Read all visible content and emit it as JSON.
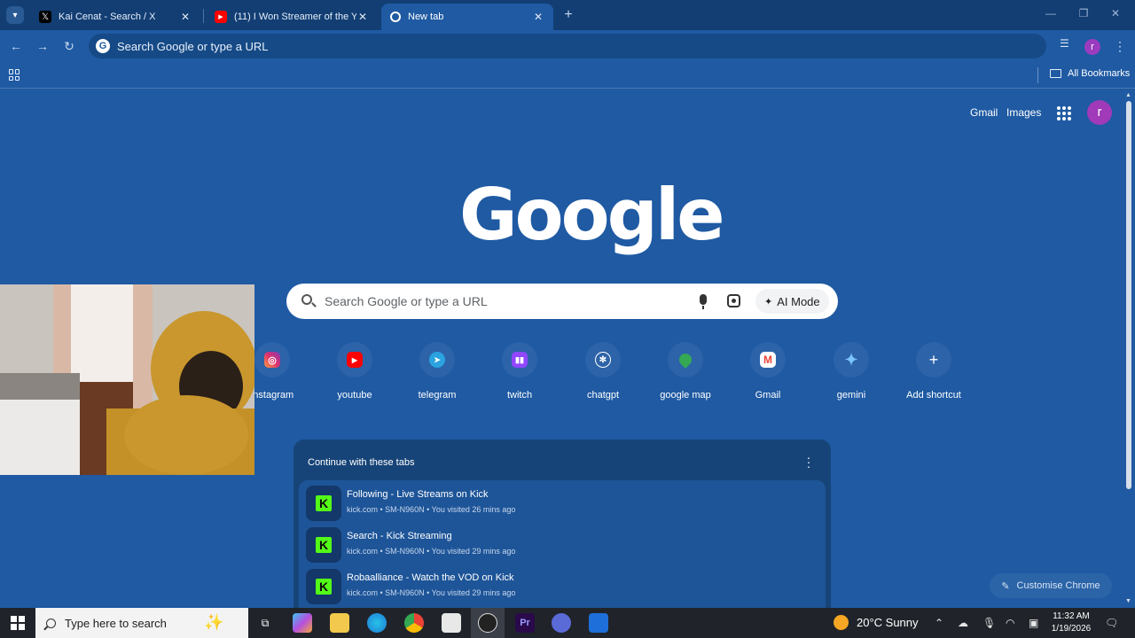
{
  "tabs": [
    {
      "title": "Kai Cenat - Search / X",
      "icon": "x-logo-icon"
    },
    {
      "title": "(11) I Won Streamer of the Year",
      "icon": "youtube-icon"
    },
    {
      "title": "New tab",
      "icon": "chrome-icon",
      "active": true
    }
  ],
  "omnibox": {
    "placeholder": "Search Google or type a URL"
  },
  "bookmarks": {
    "all_label": "All Bookmarks"
  },
  "ntp": {
    "top_links": [
      "Gmail",
      "Images"
    ],
    "avatar_letter": "r",
    "logo": "Google",
    "search_placeholder": "Search Google or type a URL",
    "ai_mode_label": "AI Mode",
    "shortcuts": [
      {
        "label": "instagram",
        "icon": "instagram-icon",
        "color": "#e1306c"
      },
      {
        "label": "youtube",
        "icon": "youtube-icon",
        "color": "#ff0000"
      },
      {
        "label": "telegram",
        "icon": "telegram-icon",
        "color": "#2aa3e0"
      },
      {
        "label": "twitch",
        "icon": "twitch-icon",
        "color": "#9146ff"
      },
      {
        "label": "chatgpt",
        "icon": "chatgpt-icon",
        "color": "#ffffff"
      },
      {
        "label": "google map",
        "icon": "google-maps-icon",
        "color": "#34a853"
      },
      {
        "label": "Gmail",
        "icon": "gmail-icon",
        "color": "#ea4335"
      },
      {
        "label": "gemini",
        "icon": "gemini-icon",
        "color": "#4f8ef7"
      },
      {
        "label": "Add shortcut",
        "icon": "plus-icon",
        "color": "#ffffff"
      }
    ],
    "continue_card": {
      "title": "Continue with these tabs",
      "items": [
        {
          "title": "Following - Live Streams on Kick",
          "meta": "kick.com • SM-N960N • You visited 26 mins ago"
        },
        {
          "title": "Search - Kick Streaming",
          "meta": "kick.com • SM-N960N • You visited 29 mins ago"
        },
        {
          "title": "Robaalliance - Watch the VOD on Kick",
          "meta": "kick.com • SM-N960N • You visited 29 mins ago"
        }
      ]
    },
    "customise_label": "Customise Chrome"
  },
  "taskbar": {
    "search_placeholder": "Type here to search",
    "weather": "20°C  Sunny",
    "time": "11:32 AM",
    "date": "1/19/2026"
  },
  "colors": {
    "page_bg": "#1f5aa3",
    "kick_green": "#53fc18",
    "taskbar": "#20242a"
  }
}
